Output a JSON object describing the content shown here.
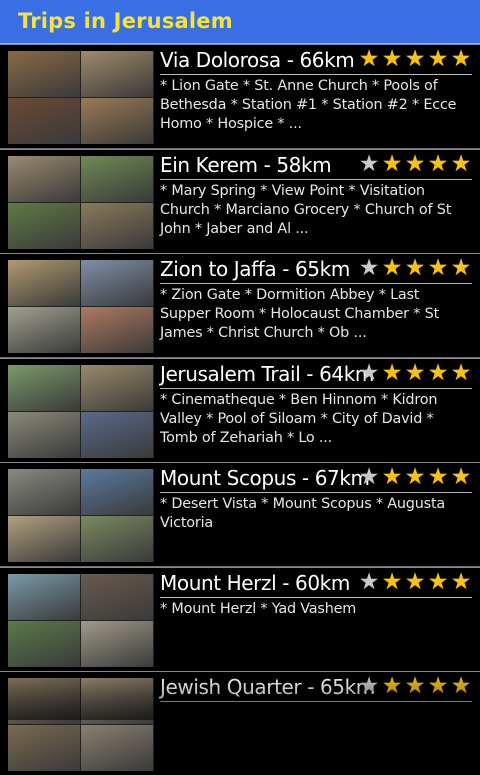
{
  "header": {
    "title": "Trips in Jerusalem"
  },
  "trips": [
    {
      "title": "Via Dolorosa - 66km",
      "rating": 5,
      "stops": "* Lion Gate * St. Anne Church * Pools of Bethesda * Station #1 * Station #2 * Ecce Homo * Hospice *  ...",
      "thumb_colors": [
        "#8a6a45",
        "#a08a6a",
        "#6a4a35",
        "#9a7a55"
      ]
    },
    {
      "title": "Ein Kerem - 58km",
      "rating": 4,
      "stops": "* Mary Spring * View Point * Visitation Church * Marciano Grocery * Church of St John * Jaber and Al ...",
      "thumb_colors": [
        "#9a8a70",
        "#6f8a55",
        "#5f7a45",
        "#8a7a5a"
      ]
    },
    {
      "title": "Zion to Jaffa - 65km",
      "rating": 4,
      "stops": "* Zion Gate * Dormition Abbey * Last Supper Room * Holocaust Chamber * St James * Christ Church * Ob ...",
      "thumb_colors": [
        "#b09a70",
        "#7f8fa8",
        "#a0a090",
        "#b07a60"
      ]
    },
    {
      "title": "Jerusalem Trail - 64km",
      "rating": 4,
      "stops": "* Cinematheque * Ben Hinnom * Kidron Valley * Pool of Siloam * City of David * Tomb of Zehariah * Lo ...",
      "thumb_colors": [
        "#7a9a6a",
        "#9a8a6a",
        "#8a8a7a",
        "#5a6a8a"
      ]
    },
    {
      "title": "Mount Scopus - 67km",
      "rating": 4,
      "stops": "* Desert Vista * Mount Scopus * Augusta Victoria",
      "thumb_colors": [
        "#8a8a80",
        "#5a7aa0",
        "#b0a080",
        "#7a8a60"
      ]
    },
    {
      "title": "Mount Herzl - 60km",
      "rating": 4,
      "stops": "* Mount Herzl * Yad Vashem",
      "thumb_colors": [
        "#7a9aa8",
        "#6a5a50",
        "#5a7a4a",
        "#a09a8a"
      ]
    },
    {
      "title": "Jewish Quarter - 65km",
      "rating": 4,
      "stops": "",
      "thumb_colors": [
        "#8a7a60",
        "#9a8a70",
        "#7a6a50",
        "#8a8070"
      ]
    }
  ],
  "icons": {
    "star_filled": "star-icon",
    "star_empty": "star-outline-icon"
  },
  "colors": {
    "header_bg": "#3a6fe4",
    "header_title": "#f4e33c",
    "star_on": "#f6c21a",
    "star_off": "#c9c9c9"
  }
}
